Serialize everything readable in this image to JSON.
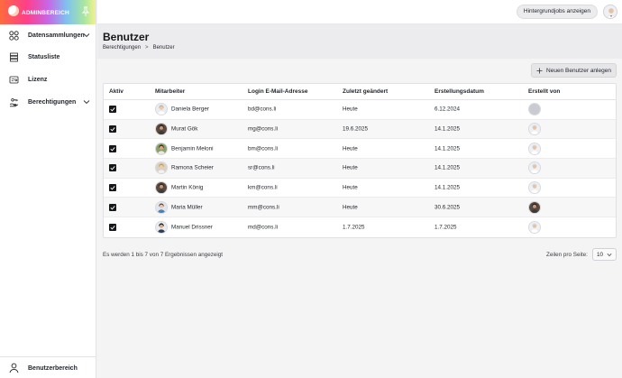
{
  "sidebar": {
    "brand": "ADMINBEREICH",
    "items": [
      {
        "label": "Datensammlungen",
        "icon": "grid-icon",
        "expandable": true
      },
      {
        "label": "Statusliste",
        "icon": "stack-icon",
        "expandable": false
      },
      {
        "label": "Lizenz",
        "icon": "license-icon",
        "expandable": false
      },
      {
        "label": "Berechtigungen",
        "icon": "hand-key-icon",
        "expandable": true
      }
    ],
    "bottom_label": "Benutzerbereich"
  },
  "topbar": {
    "jobs_button": "Hintergrundjobs anzeigen"
  },
  "page": {
    "title": "Benutzer",
    "breadcrumb": [
      "Berechtigungen",
      "Benutzer"
    ],
    "breadcrumb_sep": ">",
    "add_button": "Neuen Benutzer anlegen"
  },
  "table": {
    "headers": {
      "aktiv": "Aktiv",
      "mitarbeiter": "Mitarbeiter",
      "login": "Login E-Mail-Adresse",
      "zuletzt": "Zuletzt geändert",
      "erstellung": "Erstellungsdatum",
      "erstellt_von": "Erstellt von"
    },
    "rows": [
      {
        "active": true,
        "name": "Daniela Berger",
        "email": "bd@cons.li",
        "changed": "Heute",
        "created": "6.12.2024",
        "avatar": "woman-light",
        "creator": "empty"
      },
      {
        "active": true,
        "name": "Murat Gök",
        "email": "mg@cons.li",
        "changed": "19.6.2025",
        "created": "14.1.2025",
        "avatar": "man-dark",
        "creator": "man-light"
      },
      {
        "active": true,
        "name": "Benjamin Meloni",
        "email": "bm@cons.li",
        "changed": "Heute",
        "created": "14.1.2025",
        "avatar": "man-outdoor",
        "creator": "man-light"
      },
      {
        "active": true,
        "name": "Ramona Scheier",
        "email": "sr@cons.li",
        "changed": "Heute",
        "created": "14.1.2025",
        "avatar": "woman-blonde",
        "creator": "man-light"
      },
      {
        "active": true,
        "name": "Martin König",
        "email": "km@cons.li",
        "changed": "Heute",
        "created": "14.1.2025",
        "avatar": "man-dark",
        "creator": "man-light"
      },
      {
        "active": true,
        "name": "Maria Müller",
        "email": "mm@cons.li",
        "changed": "Heute",
        "created": "30.6.2025",
        "avatar": "woman-blue",
        "creator": "man-dark"
      },
      {
        "active": true,
        "name": "Manuel Drissner",
        "email": "md@cons.li",
        "changed": "1.7.2025",
        "created": "1.7.2025",
        "avatar": "man-suit",
        "creator": "man-light"
      }
    ]
  },
  "footer": {
    "results_text": "Es werden 1 bis 7 von 7 Ergebnissen angezeigt",
    "rows_per_page_label": "Zeilen pro Seite:",
    "rows_per_page_value": "10"
  },
  "colors": {
    "sidebar_bg": "#ffffff",
    "content_bg": "#f4f4f5",
    "header_bg": "#ececef",
    "checkbox": "#15171a"
  }
}
